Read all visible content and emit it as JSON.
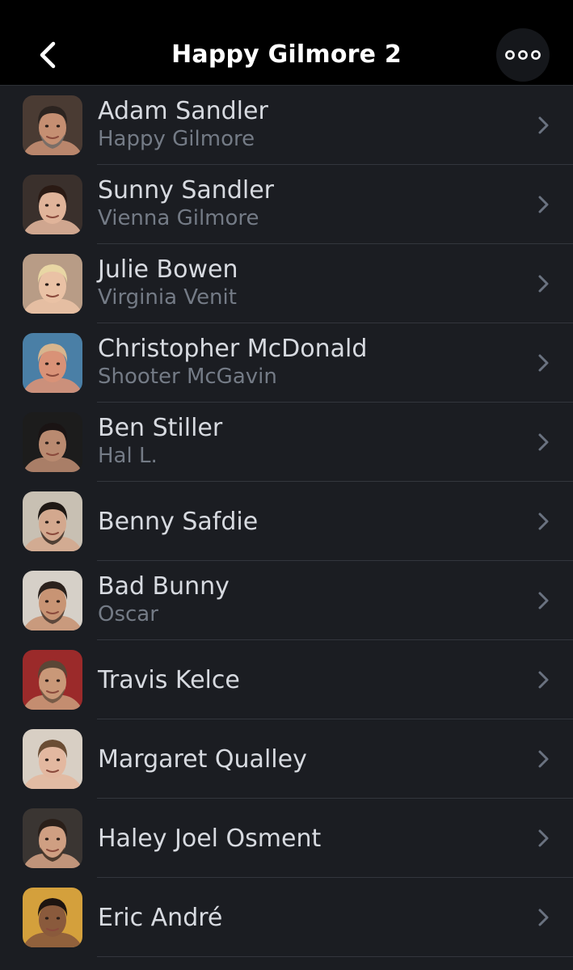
{
  "header": {
    "title": "Happy Gilmore 2",
    "back_icon": "chevron-left-icon",
    "more_icon": "more-horizontal-icon"
  },
  "colors": {
    "background": "#1b1d22",
    "header_bg": "#000000",
    "name_text": "#d7dae0",
    "role_text": "#747b86",
    "chevron": "#6a7280"
  },
  "cast": [
    {
      "name": "Adam Sandler",
      "role": "Happy Gilmore"
    },
    {
      "name": "Sunny Sandler",
      "role": "Vienna Gilmore"
    },
    {
      "name": "Julie Bowen",
      "role": "Virginia Venit"
    },
    {
      "name": "Christopher McDonald",
      "role": "Shooter McGavin"
    },
    {
      "name": "Ben Stiller",
      "role": "Hal L."
    },
    {
      "name": "Benny Safdie",
      "role": ""
    },
    {
      "name": "Bad Bunny",
      "role": "Oscar"
    },
    {
      "name": "Travis Kelce",
      "role": ""
    },
    {
      "name": "Margaret Qualley",
      "role": ""
    },
    {
      "name": "Haley Joel Osment",
      "role": ""
    },
    {
      "name": "Eric André",
      "role": ""
    }
  ]
}
